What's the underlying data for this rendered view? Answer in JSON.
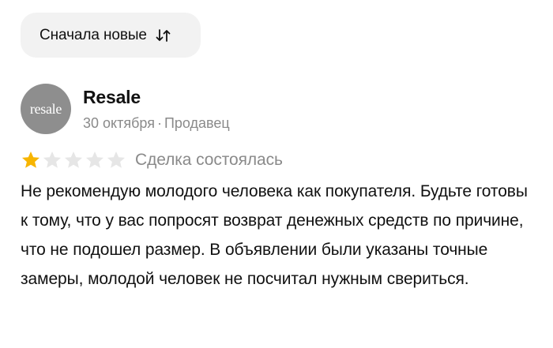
{
  "sort": {
    "label": "Сначала новые",
    "icon": "sort-arrows-icon"
  },
  "review": {
    "avatar_text": "resale",
    "author": "Resale",
    "date": "30 октября",
    "separator": "·",
    "role": "Продавец",
    "rating": 1,
    "rating_max": 5,
    "star_filled_color": "#f7b500",
    "star_empty_color": "#e6e6e6",
    "deal_status": "Сделка состоялась",
    "text": "Не рекомендую молодого человека как покупателя. Будьте готовы к тому, что у вас попросят возврат денежных средств по причине, что не подошел размер. В объявлении были указаны точные замеры, молодой человек не посчитал нужным свериться."
  }
}
